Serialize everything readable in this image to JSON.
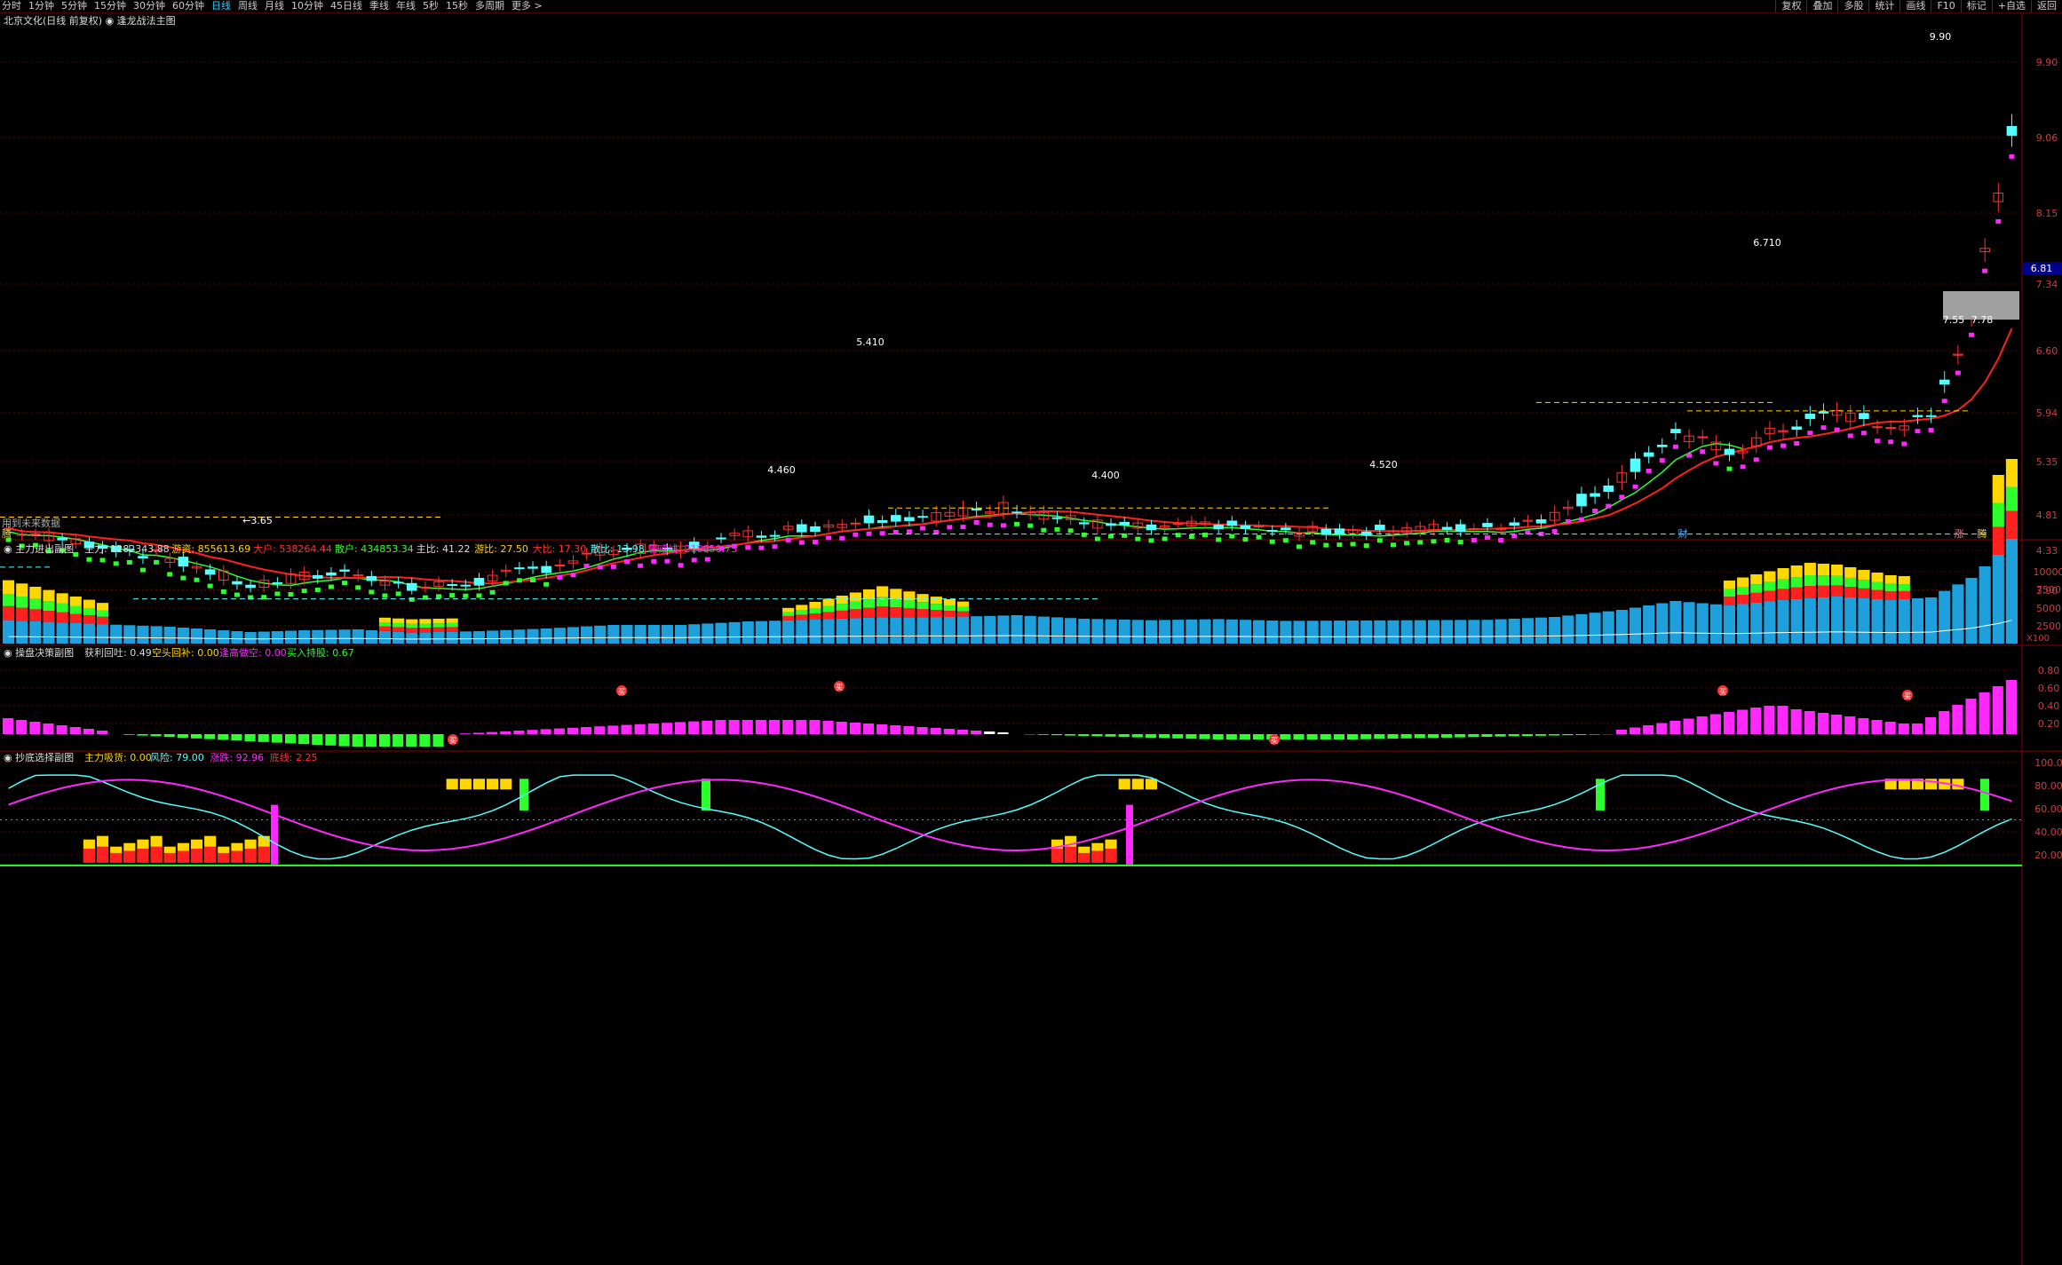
{
  "toolbar": {
    "periods": [
      "分时",
      "1分钟",
      "5分钟",
      "15分钟",
      "30分钟",
      "60分钟",
      "日线",
      "周线",
      "月线",
      "10分钟",
      "45日线",
      "季线",
      "年线",
      "5秒",
      "15秒",
      "多周期",
      "更多 >"
    ],
    "active_period": "日线",
    "right_buttons": [
      "复权",
      "叠加",
      "多股",
      "统计",
      "画线",
      "F10",
      "标记",
      "+自选",
      "返回"
    ]
  },
  "colors": {
    "up": "#ff3232",
    "down": "#54ffff",
    "magenta": "#ff28ff",
    "green": "#2dff2d",
    "yellow": "#ffd700",
    "red": "#ff2020",
    "blue": "#1ea0dc",
    "grid": "#5a0000",
    "axis": "#8a0000"
  },
  "chart_data": [
    {
      "panel": "main",
      "type": "candlestick",
      "title": "北京文化(日线 前复权) ◉ 逢龙战法主图",
      "yticks": [
        "9.90",
        "9.06",
        "8.15",
        "7.34",
        "6.60",
        "5.94",
        "5.35",
        "4.81",
        "4.33",
        "3.90"
      ],
      "ylim": [
        3.65,
        9.9
      ],
      "annotations": [
        "5.410",
        "4.460",
        "4.400",
        "4.520",
        "6.710",
        "7.55",
        "7.78",
        "3.65",
        "9.90"
      ],
      "price_tag": "6.81",
      "bottom_left_text": "用到未来数据",
      "markers": [
        "财",
        "涨",
        "腾"
      ],
      "left_marker": "腾"
    },
    {
      "panel": "sub1",
      "type": "bar",
      "title": "主力进出副图",
      "readouts": [
        {
          "label": "主力: 1282343.88",
          "color": "#dddddd"
        },
        {
          "label": "游资: 855613.69",
          "color": "#ffd700"
        },
        {
          "label": "大户: 538264.44",
          "color": "#ff3232"
        },
        {
          "label": "散户: 434853.34",
          "color": "#2dff2d"
        },
        {
          "label": "主比: 41.22",
          "color": "#dddddd"
        },
        {
          "label": "游比: 27.50",
          "color": "#ffd700"
        },
        {
          "label": "大比: 17.30",
          "color": "#ff3232"
        },
        {
          "label": "散比: 13.98",
          "color": "#54ffff"
        },
        {
          "label": "警戒线: 218850.73",
          "color": "#ff28ff"
        }
      ],
      "yticks": [
        "10000",
        "7500",
        "5000",
        "2500"
      ],
      "unit": "X100"
    },
    {
      "panel": "sub2",
      "type": "bar",
      "title": "操盘决策副图",
      "readouts": [
        {
          "label": "获利回吐: 0.49",
          "color": "#dddddd"
        },
        {
          "label": "空头回补: 0.00",
          "color": "#ffd700"
        },
        {
          "label": "逢高做空: 0.00",
          "color": "#ff28ff"
        },
        {
          "label": "买入持股: 0.67",
          "color": "#2dff2d"
        }
      ],
      "yticks": [
        "0.80",
        "0.60",
        "0.40",
        "0.20"
      ],
      "marker": "买"
    },
    {
      "panel": "sub3",
      "type": "line",
      "title": "抄底选择副图",
      "readouts": [
        {
          "label": "主力吸货: 0.00",
          "color": "#ffd700"
        },
        {
          "label": "风险: 79.00",
          "color": "#54ffff"
        },
        {
          "label": "涨跌: 92.96",
          "color": "#ff28ff"
        },
        {
          "label": "底线: 2.25",
          "color": "#ff3232"
        }
      ],
      "yticks": [
        "100.0",
        "80.00",
        "60.00",
        "40.00",
        "20.00"
      ]
    }
  ]
}
